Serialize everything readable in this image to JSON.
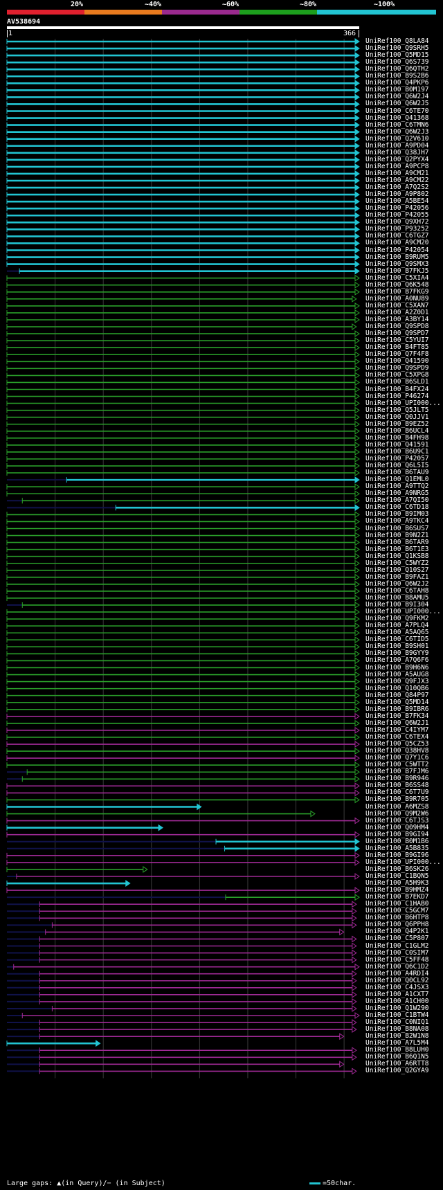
{
  "header": {
    "percent_labels": [
      "20%",
      "~40%",
      "~60%",
      "~80%",
      "~100%"
    ],
    "percent_colors": [
      "#e0202e",
      "#e87a1e",
      "#9a2a8e",
      "#1d9e1d",
      "#22c4d2"
    ],
    "query_id": "AV538694",
    "ruler_start": "1",
    "ruler_end": "366"
  },
  "colors": {
    "cyan": "#22c4d2",
    "green": "#2aa02a",
    "magenta": "#a02a96",
    "navy": "#10124a",
    "grid": "#3a3a3a"
  },
  "hits": [
    {
      "id": "UniRef100_Q8LA84",
      "color": "cyan",
      "start": 1,
      "end": 366
    },
    {
      "id": "UniRef100_Q9SRH5",
      "color": "cyan",
      "start": 1,
      "end": 366
    },
    {
      "id": "UniRef100_Q5MD15",
      "color": "cyan",
      "start": 1,
      "end": 366
    },
    {
      "id": "UniRef100_Q6S739",
      "color": "cyan",
      "start": 1,
      "end": 366
    },
    {
      "id": "UniRef100_Q6QTH2",
      "color": "cyan",
      "start": 1,
      "end": 366
    },
    {
      "id": "UniRef100_B9S2B6",
      "color": "cyan",
      "start": 1,
      "end": 366
    },
    {
      "id": "UniRef100_Q4PKP6",
      "color": "cyan",
      "start": 1,
      "end": 366
    },
    {
      "id": "UniRef100_B0M197",
      "color": "cyan",
      "start": 1,
      "end": 366
    },
    {
      "id": "UniRef100_Q6W2J4",
      "color": "cyan",
      "start": 1,
      "end": 366
    },
    {
      "id": "UniRef100_Q6W2J5",
      "color": "cyan",
      "start": 1,
      "end": 366
    },
    {
      "id": "UniRef100_C6TE70",
      "color": "cyan",
      "start": 1,
      "end": 366
    },
    {
      "id": "UniRef100_Q41368",
      "color": "cyan",
      "start": 1,
      "end": 366
    },
    {
      "id": "UniRef100_C6TMN6",
      "color": "cyan",
      "start": 1,
      "end": 366
    },
    {
      "id": "UniRef100_Q6W2J3",
      "color": "cyan",
      "start": 1,
      "end": 366
    },
    {
      "id": "UniRef100_Q2V610",
      "color": "cyan",
      "start": 1,
      "end": 366
    },
    {
      "id": "UniRef100_A9PD04",
      "color": "cyan",
      "start": 1,
      "end": 366
    },
    {
      "id": "UniRef100_Q38JH7",
      "color": "cyan",
      "start": 1,
      "end": 366
    },
    {
      "id": "UniRef100_Q2PYX4",
      "color": "cyan",
      "start": 1,
      "end": 366
    },
    {
      "id": "UniRef100_A9PCP8",
      "color": "cyan",
      "start": 1,
      "end": 366
    },
    {
      "id": "UniRef100_A9CM21",
      "color": "cyan",
      "start": 1,
      "end": 366
    },
    {
      "id": "UniRef100_A9CM22",
      "color": "cyan",
      "start": 1,
      "end": 366
    },
    {
      "id": "UniRef100_A7Q2S2",
      "color": "cyan",
      "start": 1,
      "end": 366
    },
    {
      "id": "UniRef100_A9P802",
      "color": "cyan",
      "start": 1,
      "end": 366
    },
    {
      "id": "UniRef100_A5BE54",
      "color": "cyan",
      "start": 1,
      "end": 366
    },
    {
      "id": "UniRef100_P42056",
      "color": "cyan",
      "start": 1,
      "end": 366
    },
    {
      "id": "UniRef100_P42055",
      "color": "cyan",
      "start": 1,
      "end": 366
    },
    {
      "id": "UniRef100_Q9XH72",
      "color": "cyan",
      "start": 1,
      "end": 366
    },
    {
      "id": "UniRef100_P93252",
      "color": "cyan",
      "start": 1,
      "end": 366
    },
    {
      "id": "UniRef100_C6TGZ7",
      "color": "cyan",
      "start": 1,
      "end": 366
    },
    {
      "id": "UniRef100_A9CM20",
      "color": "cyan",
      "start": 1,
      "end": 366
    },
    {
      "id": "UniRef100_P42054",
      "color": "cyan",
      "start": 1,
      "end": 366
    },
    {
      "id": "UniRef100_B9RUM5",
      "color": "cyan",
      "start": 1,
      "end": 366
    },
    {
      "id": "UniRef100_Q9SMX3",
      "color": "cyan",
      "start": 1,
      "end": 366
    },
    {
      "id": "UniRef100_B7FKJ5",
      "color": "cyan",
      "start": 14,
      "end": 366
    },
    {
      "id": "UniRef100_C5XIA4",
      "color": "green",
      "start": 1,
      "end": 366
    },
    {
      "id": "UniRef100_Q6K548",
      "color": "green",
      "start": 1,
      "end": 366
    },
    {
      "id": "UniRef100_B7FKG9",
      "color": "green",
      "start": 1,
      "end": 366
    },
    {
      "id": "UniRef100_A0NU89",
      "color": "green",
      "start": 1,
      "end": 363
    },
    {
      "id": "UniRef100_C5XAN7",
      "color": "green",
      "start": 1,
      "end": 366
    },
    {
      "id": "UniRef100_A2Z0D1",
      "color": "green",
      "start": 1,
      "end": 366
    },
    {
      "id": "UniRef100_A3BY14",
      "color": "green",
      "start": 1,
      "end": 366
    },
    {
      "id": "UniRef100_Q9SPD8",
      "color": "green",
      "start": 1,
      "end": 363
    },
    {
      "id": "UniRef100_Q9SPD7",
      "color": "green",
      "start": 1,
      "end": 366
    },
    {
      "id": "UniRef100_C5YUI7",
      "color": "green",
      "start": 1,
      "end": 366
    },
    {
      "id": "UniRef100_B4FT85",
      "color": "green",
      "start": 1,
      "end": 366
    },
    {
      "id": "UniRef100_Q7F4F8",
      "color": "green",
      "start": 1,
      "end": 366
    },
    {
      "id": "UniRef100_Q41590",
      "color": "green",
      "start": 1,
      "end": 366
    },
    {
      "id": "UniRef100_Q9SPD9",
      "color": "green",
      "start": 1,
      "end": 366
    },
    {
      "id": "UniRef100_C5XPG8",
      "color": "green",
      "start": 1,
      "end": 366
    },
    {
      "id": "UniRef100_B6SLD1",
      "color": "green",
      "start": 1,
      "end": 366
    },
    {
      "id": "UniRef100_B4FX24",
      "color": "green",
      "start": 1,
      "end": 366
    },
    {
      "id": "UniRef100_P46274",
      "color": "green",
      "start": 1,
      "end": 366
    },
    {
      "id": "UniRef100_UPI000...",
      "color": "green",
      "start": 1,
      "end": 366
    },
    {
      "id": "UniRef100_Q5JLT5",
      "color": "green",
      "start": 1,
      "end": 366
    },
    {
      "id": "UniRef100_Q0JJV1",
      "color": "green",
      "start": 1,
      "end": 366
    },
    {
      "id": "UniRef100_B9EZ52",
      "color": "green",
      "start": 1,
      "end": 366
    },
    {
      "id": "UniRef100_B6UCL4",
      "color": "green",
      "start": 1,
      "end": 366
    },
    {
      "id": "UniRef100_B4FH98",
      "color": "green",
      "start": 1,
      "end": 366
    },
    {
      "id": "UniRef100_Q41591",
      "color": "green",
      "start": 1,
      "end": 366
    },
    {
      "id": "UniRef100_B6U9C1",
      "color": "green",
      "start": 1,
      "end": 366
    },
    {
      "id": "UniRef100_P42057",
      "color": "green",
      "start": 1,
      "end": 366
    },
    {
      "id": "UniRef100_Q6L5I5",
      "color": "green",
      "start": 1,
      "end": 366
    },
    {
      "id": "UniRef100_B6TAU9",
      "color": "green",
      "start": 1,
      "end": 366
    },
    {
      "id": "UniRef100_Q1EML0",
      "color": "cyan",
      "start": 63,
      "end": 366
    },
    {
      "id": "UniRef100_A9TTQ2",
      "color": "green",
      "start": 1,
      "end": 366
    },
    {
      "id": "UniRef100_A9NRG5",
      "color": "green",
      "start": 1,
      "end": 366
    },
    {
      "id": "UniRef100_A7QI50",
      "color": "green",
      "start": 17,
      "end": 366
    },
    {
      "id": "UniRef100_C6TD18",
      "color": "cyan",
      "start": 114,
      "end": 366
    },
    {
      "id": "UniRef100_B9IM03",
      "color": "green",
      "start": 1,
      "end": 366
    },
    {
      "id": "UniRef100_A9TKC4",
      "color": "green",
      "start": 1,
      "end": 366
    },
    {
      "id": "UniRef100_B6SUS7",
      "color": "green",
      "start": 1,
      "end": 366
    },
    {
      "id": "UniRef100_B9N2Z1",
      "color": "green",
      "start": 1,
      "end": 366
    },
    {
      "id": "UniRef100_B6TAR9",
      "color": "green",
      "start": 1,
      "end": 366
    },
    {
      "id": "UniRef100_B6T1E3",
      "color": "green",
      "start": 1,
      "end": 366
    },
    {
      "id": "UniRef100_Q1KSB8",
      "color": "green",
      "start": 1,
      "end": 366
    },
    {
      "id": "UniRef100_C5WYZ2",
      "color": "green",
      "start": 1,
      "end": 366
    },
    {
      "id": "UniRef100_Q10S27",
      "color": "green",
      "start": 1,
      "end": 366
    },
    {
      "id": "UniRef100_B9FAZ1",
      "color": "green",
      "start": 1,
      "end": 366
    },
    {
      "id": "UniRef100_Q6W2J2",
      "color": "green",
      "start": 1,
      "end": 366
    },
    {
      "id": "UniRef100_C6TAH8",
      "color": "green",
      "start": 1,
      "end": 366
    },
    {
      "id": "UniRef100_B8AMU5",
      "color": "green",
      "start": 1,
      "end": 366
    },
    {
      "id": "UniRef100_B9I304",
      "color": "green",
      "start": 17,
      "end": 366
    },
    {
      "id": "UniRef100_UPI000...",
      "color": "green",
      "start": 1,
      "end": 366
    },
    {
      "id": "UniRef100_Q9FKM2",
      "color": "green",
      "start": 1,
      "end": 366
    },
    {
      "id": "UniRef100_A7PLQ4",
      "color": "green",
      "start": 1,
      "end": 366
    },
    {
      "id": "UniRef100_A5AQ65",
      "color": "green",
      "start": 1,
      "end": 366
    },
    {
      "id": "UniRef100_C6TID5",
      "color": "green",
      "start": 1,
      "end": 366
    },
    {
      "id": "UniRef100_B9SH01",
      "color": "green",
      "start": 1,
      "end": 366
    },
    {
      "id": "UniRef100_B9GYY9",
      "color": "green",
      "start": 1,
      "end": 366
    },
    {
      "id": "UniRef100_A7Q6F6",
      "color": "green",
      "start": 1,
      "end": 366
    },
    {
      "id": "UniRef100_B9H6N6",
      "color": "green",
      "start": 1,
      "end": 366
    },
    {
      "id": "UniRef100_A5AUG8",
      "color": "green",
      "start": 1,
      "end": 366
    },
    {
      "id": "UniRef100_Q9FJX3",
      "color": "green",
      "start": 1,
      "end": 366
    },
    {
      "id": "UniRef100_Q10QB6",
      "color": "green",
      "start": 1,
      "end": 366
    },
    {
      "id": "UniRef100_Q84P97",
      "color": "green",
      "start": 1,
      "end": 366
    },
    {
      "id": "UniRef100_Q5MD14",
      "color": "green",
      "start": 1,
      "end": 366
    },
    {
      "id": "UniRef100_B9IBR6",
      "color": "green",
      "start": 1,
      "end": 366
    },
    {
      "id": "UniRef100_B7FK34",
      "color": "magenta",
      "start": 1,
      "end": 366
    },
    {
      "id": "UniRef100_Q6W2J1",
      "color": "green",
      "start": 1,
      "end": 366
    },
    {
      "id": "UniRef100_C4IYM7",
      "color": "magenta",
      "start": 1,
      "end": 366
    },
    {
      "id": "UniRef100_C6TEX4",
      "color": "green",
      "start": 1,
      "end": 366
    },
    {
      "id": "UniRef100_Q5CZ53",
      "color": "magenta",
      "start": 1,
      "end": 366
    },
    {
      "id": "UniRef100_Q38HV8",
      "color": "green",
      "start": 1,
      "end": 366
    },
    {
      "id": "UniRef100_Q7Y1C6",
      "color": "magenta",
      "start": 1,
      "end": 366
    },
    {
      "id": "UniRef100_C5WTT2",
      "color": "green",
      "start": 1,
      "end": 366
    },
    {
      "id": "UniRef100_B7FJM6",
      "color": "green",
      "start": 22,
      "end": 366
    },
    {
      "id": "UniRef100_B9R946",
      "color": "green",
      "start": 17,
      "end": 366
    },
    {
      "id": "UniRef100_B6SS48",
      "color": "magenta",
      "start": 1,
      "end": 366
    },
    {
      "id": "UniRef100_C6T7U9",
      "color": "magenta",
      "start": 1,
      "end": 366
    },
    {
      "id": "UniRef100_B9R705",
      "color": "green",
      "start": 1,
      "end": 366
    },
    {
      "id": "UniRef100_A6MZS8",
      "color": "cyan",
      "start": 1,
      "end": 202
    },
    {
      "id": "UniRef100_Q9M2W6",
      "color": "green",
      "start": 1,
      "end": 320
    },
    {
      "id": "UniRef100_C6TJS3",
      "color": "magenta",
      "start": 1,
      "end": 366
    },
    {
      "id": "UniRef100_Q09HM4",
      "color": "cyan",
      "start": 1,
      "end": 162
    },
    {
      "id": "UniRef100_B9GI94",
      "color": "magenta",
      "start": 1,
      "end": 366
    },
    {
      "id": "UniRef100_B0M1B6",
      "color": "cyan",
      "start": 218,
      "end": 366
    },
    {
      "id": "UniRef100_A5B835",
      "color": "cyan",
      "start": 227,
      "end": 366
    },
    {
      "id": "UniRef100_B9GI96",
      "color": "magenta",
      "start": 1,
      "end": 366
    },
    {
      "id": "UniRef100_UPI000...",
      "color": "magenta",
      "start": 1,
      "end": 366
    },
    {
      "id": "UniRef100_B6SK26",
      "color": "green",
      "start": 1,
      "end": 146
    },
    {
      "id": "UniRef100_C1BQN5",
      "color": "magenta",
      "start": 11,
      "end": 366
    },
    {
      "id": "UniRef100_A5H9K3",
      "color": "cyan",
      "start": 1,
      "end": 128
    },
    {
      "id": "UniRef100_B9HMZ4",
      "color": "magenta",
      "start": 1,
      "end": 366
    },
    {
      "id": "UniRef100_B7EKD7",
      "color": "green",
      "start": 228,
      "end": 366
    },
    {
      "id": "UniRef100_C1HAB0",
      "color": "magenta",
      "start": 35,
      "end": 363
    },
    {
      "id": "UniRef100_C5GCM7",
      "color": "magenta",
      "start": 35,
      "end": 363
    },
    {
      "id": "UniRef100_B6HTP8",
      "color": "magenta",
      "start": 35,
      "end": 363
    },
    {
      "id": "UniRef100_Q6PPH8",
      "color": "magenta",
      "start": 48,
      "end": 363
    },
    {
      "id": "UniRef100_Q4P2K1",
      "color": "magenta",
      "start": 41,
      "end": 350
    },
    {
      "id": "UniRef100_C5P807",
      "color": "magenta",
      "start": 35,
      "end": 363
    },
    {
      "id": "UniRef100_C1GLM2",
      "color": "magenta",
      "start": 35,
      "end": 363
    },
    {
      "id": "UniRef100_C0SIM7",
      "color": "magenta",
      "start": 35,
      "end": 363
    },
    {
      "id": "UniRef100_C5FF48",
      "color": "magenta",
      "start": 35,
      "end": 363
    },
    {
      "id": "UniRef100_Q6C1D2",
      "color": "magenta",
      "start": 8,
      "end": 366
    },
    {
      "id": "UniRef100_A4RDI4",
      "color": "magenta",
      "start": 35,
      "end": 363
    },
    {
      "id": "UniRef100_Q0CL92",
      "color": "magenta",
      "start": 35,
      "end": 363
    },
    {
      "id": "UniRef100_C4JSX3",
      "color": "magenta",
      "start": 35,
      "end": 363
    },
    {
      "id": "UniRef100_A1CXT7",
      "color": "magenta",
      "start": 35,
      "end": 363
    },
    {
      "id": "UniRef100_A1CH00",
      "color": "magenta",
      "start": 35,
      "end": 363
    },
    {
      "id": "UniRef100_Q1W290",
      "color": "magenta",
      "start": 48,
      "end": 363
    },
    {
      "id": "UniRef100_C1BTW4",
      "color": "magenta",
      "start": 17,
      "end": 366
    },
    {
      "id": "UniRef100_C0NIQ1",
      "color": "magenta",
      "start": 35,
      "end": 363
    },
    {
      "id": "UniRef100_B8NA08",
      "color": "magenta",
      "start": 35,
      "end": 363
    },
    {
      "id": "UniRef100_B2W1N8",
      "color": "magenta",
      "start": 35,
      "end": 350
    },
    {
      "id": "UniRef100_A7L5M4",
      "color": "cyan",
      "start": 1,
      "end": 97
    },
    {
      "id": "UniRef100_B8LUH0",
      "color": "magenta",
      "start": 35,
      "end": 363
    },
    {
      "id": "UniRef100_B6Q1N5",
      "color": "magenta",
      "start": 35,
      "end": 363
    },
    {
      "id": "UniRef100_A6RTT8",
      "color": "magenta",
      "start": 35,
      "end": 350
    },
    {
      "id": "UniRef100_Q2GYA9",
      "color": "magenta",
      "start": 35,
      "end": 363
    }
  ],
  "legend": {
    "left_text": "Large gaps: ▲(in Query)/− (in Subject)",
    "right_text": "=50char."
  }
}
